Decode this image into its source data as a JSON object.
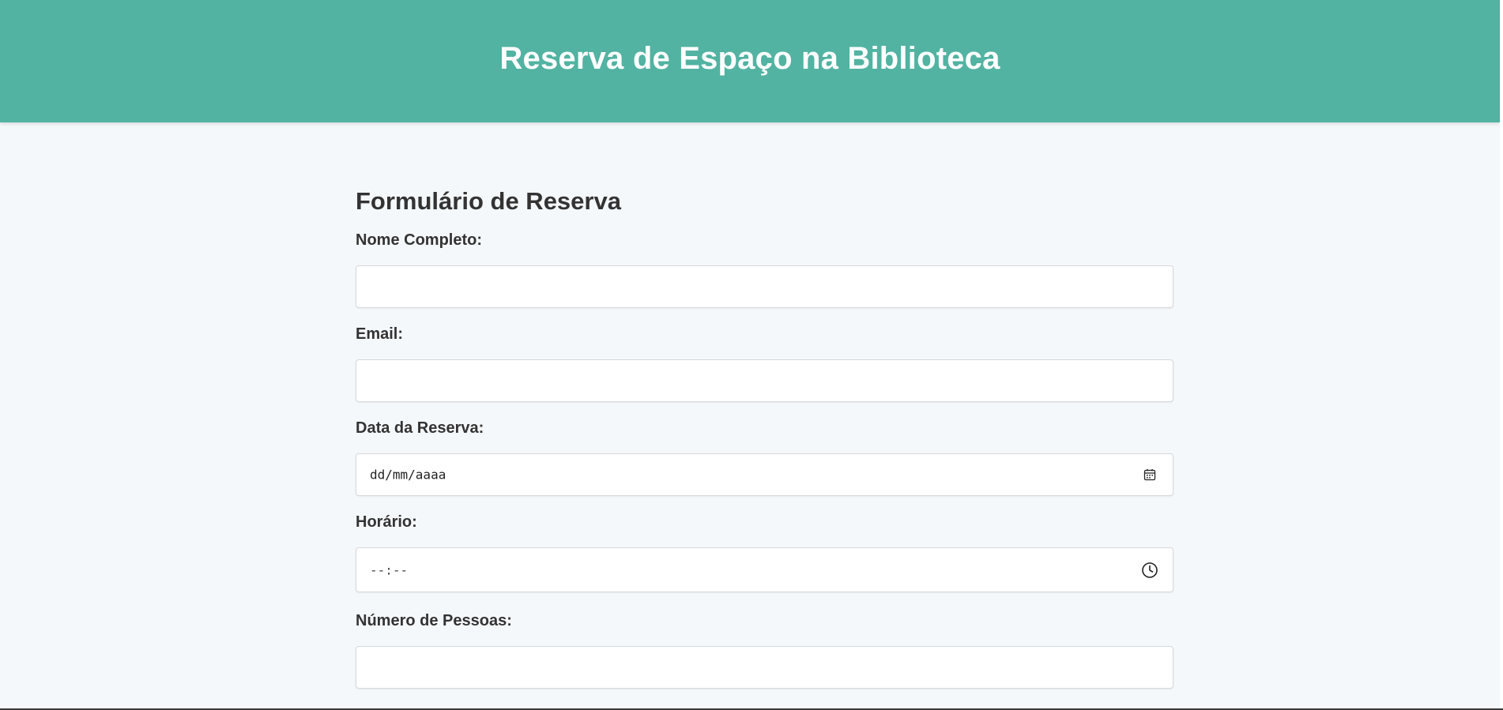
{
  "header": {
    "title": "Reserva de Espaço na Biblioteca",
    "background_color": "#52b3a2"
  },
  "form": {
    "title": "Formulário de Reserva",
    "fields": [
      {
        "label": "Nome Completo:",
        "value": "",
        "placeholder": ""
      },
      {
        "label": "Email:",
        "value": "",
        "placeholder": ""
      },
      {
        "label": "Data da Reserva:",
        "value": "",
        "placeholder": "dd/mm/aaaa",
        "icon": "calendar-icon"
      },
      {
        "label": "Horário:",
        "value": "",
        "placeholder": "--:--",
        "icon": "clock-icon"
      },
      {
        "label": "Número de Pessoas:",
        "value": "",
        "placeholder": ""
      }
    ]
  }
}
